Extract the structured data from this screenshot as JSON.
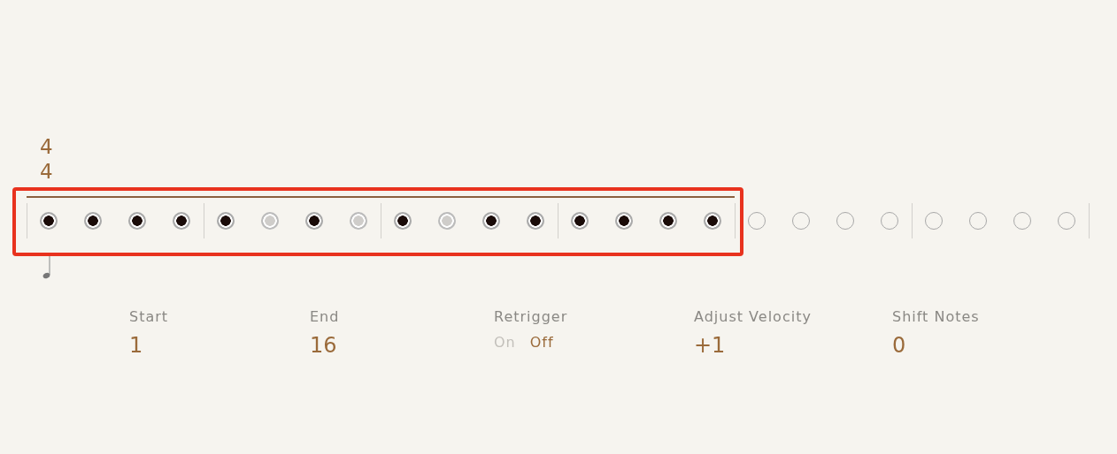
{
  "time_signature": {
    "numerator": "4",
    "denominator": "4"
  },
  "pattern": {
    "range_bars": [
      {
        "steps": [
          {
            "kind": "on"
          },
          {
            "kind": "on"
          },
          {
            "kind": "on"
          },
          {
            "kind": "on"
          }
        ]
      },
      {
        "steps": [
          {
            "kind": "on"
          },
          {
            "kind": "muted"
          },
          {
            "kind": "on"
          },
          {
            "kind": "muted"
          }
        ]
      },
      {
        "steps": [
          {
            "kind": "on"
          },
          {
            "kind": "muted"
          },
          {
            "kind": "on"
          },
          {
            "kind": "on"
          }
        ]
      },
      {
        "steps": [
          {
            "kind": "on"
          },
          {
            "kind": "on"
          },
          {
            "kind": "on"
          },
          {
            "kind": "on"
          }
        ]
      }
    ],
    "extra_bars": [
      {
        "steps": [
          {
            "kind": "empty"
          },
          {
            "kind": "empty"
          },
          {
            "kind": "empty"
          },
          {
            "kind": "empty"
          }
        ]
      },
      {
        "steps": [
          {
            "kind": "empty"
          },
          {
            "kind": "empty"
          },
          {
            "kind": "empty"
          },
          {
            "kind": "empty"
          }
        ]
      }
    ]
  },
  "params": [
    {
      "kind": "value",
      "label": "Start",
      "value": "1"
    },
    {
      "kind": "value",
      "label": "End",
      "value": "16"
    },
    {
      "kind": "toggle",
      "label": "Retrigger",
      "options": [
        {
          "label": "On",
          "selected": false
        },
        {
          "label": "Off",
          "selected": true
        }
      ]
    },
    {
      "kind": "value",
      "label": "Adjust Velocity",
      "value": "+1"
    },
    {
      "kind": "value",
      "label": "Shift Notes",
      "value": "0"
    }
  ]
}
